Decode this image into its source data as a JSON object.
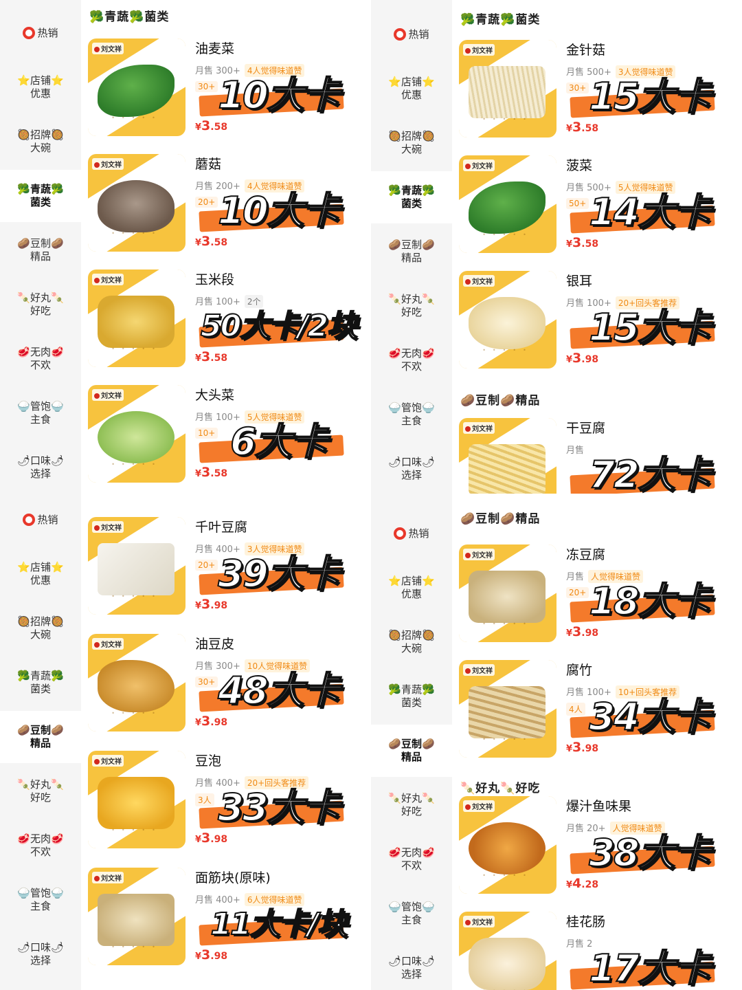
{
  "categories": [
    {
      "label": "热销",
      "icon": "hot-ring-icon"
    },
    {
      "label": "⭐店铺⭐\n优惠",
      "icon": "star-icon"
    },
    {
      "label": "🥘招牌🥘\n大碗",
      "icon": "bowl-icon"
    },
    {
      "label": "🥦青蔬🥦\n菌类",
      "icon": "broccoli-icon"
    },
    {
      "label": "🥔豆制🥔\n精品",
      "icon": "potato-icon"
    },
    {
      "label": "🍡好丸🍡\n好吃",
      "icon": "skewer-icon"
    },
    {
      "label": "🥩无肉🥩\n不欢",
      "icon": "meat-icon"
    },
    {
      "label": "🍚管饱🍚\n主食",
      "icon": "rice-icon"
    },
    {
      "label": "🌶口味🌶\n选择",
      "icon": "chili-icon"
    }
  ],
  "panels": {
    "tl": {
      "active": 3,
      "section": "🥦青蔬🥦菌类",
      "items": [
        {
          "name": "油麦菜",
          "sales": "月售 300+",
          "tag": "4人觉得味道赞",
          "promo": "30+",
          "price_int": "3",
          "price_dec": ".58",
          "kcal": "10大卡",
          "food": "veg"
        },
        {
          "name": "蘑菇",
          "sales": "月售 200+",
          "tag": "4人觉得味道赞",
          "promo": "20+",
          "price_int": "3",
          "price_dec": ".58",
          "kcal": "10大卡",
          "food": "mush"
        },
        {
          "name": "玉米段",
          "sales": "月售 100+",
          "tag": "2个",
          "tag_gray": true,
          "promo": "",
          "price_int": "3",
          "price_dec": ".58",
          "kcal": "50大卡/2块",
          "food": "corn"
        },
        {
          "name": "大头菜",
          "sales": "月售 100+",
          "tag": "5人觉得味道赞",
          "promo": "10+",
          "price_int": "3",
          "price_dec": ".58",
          "kcal": "6大卡",
          "food": "cab"
        }
      ]
    },
    "tr": {
      "active": 3,
      "sections": [
        "🥦青蔬🥦菌类",
        "🥔豆制🥔精品"
      ],
      "items": [
        {
          "name": "金针菇",
          "sales": "月售 500+",
          "tag": "3人觉得味道赞",
          "promo": "30+",
          "price_int": "3",
          "price_dec": ".58",
          "kcal": "15大卡",
          "food": "needle"
        },
        {
          "name": "菠菜",
          "sales": "月售 500+",
          "tag": "5人觉得味道赞",
          "promo": "50+",
          "price_int": "3",
          "price_dec": ".58",
          "kcal": "14大卡",
          "food": "veg"
        },
        {
          "name": "银耳",
          "sales": "月售 100+",
          "tag": "20+回头客推荐",
          "promo": "",
          "price_int": "3",
          "price_dec": ".98",
          "kcal": "15大卡",
          "food": "fungus"
        },
        {
          "name": "干豆腐",
          "sales": "月售",
          "tag": "",
          "promo": "",
          "price_int": "",
          "price_dec": "",
          "kcal": "72大卡",
          "food": "strip"
        }
      ]
    },
    "bl": {
      "active": 4,
      "items": [
        {
          "name": "千叶豆腐",
          "sales": "月售 400+",
          "tag": "3人觉得味道赞",
          "promo": "20+",
          "price_int": "3",
          "price_dec": ".98",
          "kcal": "39大卡",
          "food": "tofu"
        },
        {
          "name": "油豆皮",
          "sales": "月售 300+",
          "tag": "10人觉得味道赞",
          "promo": "30+",
          "price_int": "3",
          "price_dec": ".98",
          "kcal": "48大卡",
          "food": "skin"
        },
        {
          "name": "豆泡",
          "sales": "月售 400+",
          "tag": "20+回头客推荐",
          "promo": "3人",
          "price_int": "3",
          "price_dec": ".98",
          "kcal": "33大卡",
          "food": "puff"
        },
        {
          "name": "面筋块(原味)",
          "sales": "月售 400+",
          "tag": "6人觉得味道赞",
          "promo": "",
          "price_int": "3",
          "price_dec": ".98",
          "kcal": "11大卡/块",
          "food": "gluten"
        }
      ]
    },
    "br": {
      "active": 4,
      "sections": [
        "🥔豆制🥔精品",
        "🍡好丸🍡好吃"
      ],
      "items": [
        {
          "name": "冻豆腐",
          "sales": "月售",
          "tag": "人觉得味道赞",
          "promo": "20+",
          "price_int": "3",
          "price_dec": ".98",
          "kcal": "18大卡",
          "food": "frozen"
        },
        {
          "name": "腐竹",
          "sales": "月售 100+",
          "tag": "10+回头客推荐",
          "promo": "4人",
          "price_int": "3",
          "price_dec": ".98",
          "kcal": "34大卡",
          "food": "stick"
        },
        {
          "name": "爆汁鱼味果",
          "sales": "月售 20+",
          "tag": "人觉得味道赞",
          "promo": "",
          "price_int": "4",
          "price_dec": ".28",
          "kcal": "38大卡",
          "food": "ball"
        },
        {
          "name": "桂花肠",
          "sales": "月售 2",
          "tag": "",
          "promo": "",
          "price_int": "",
          "price_dec": "",
          "kcal": "17大卡",
          "food": "sausage"
        }
      ]
    }
  },
  "logo_text": "刘文祥",
  "currency": "¥"
}
